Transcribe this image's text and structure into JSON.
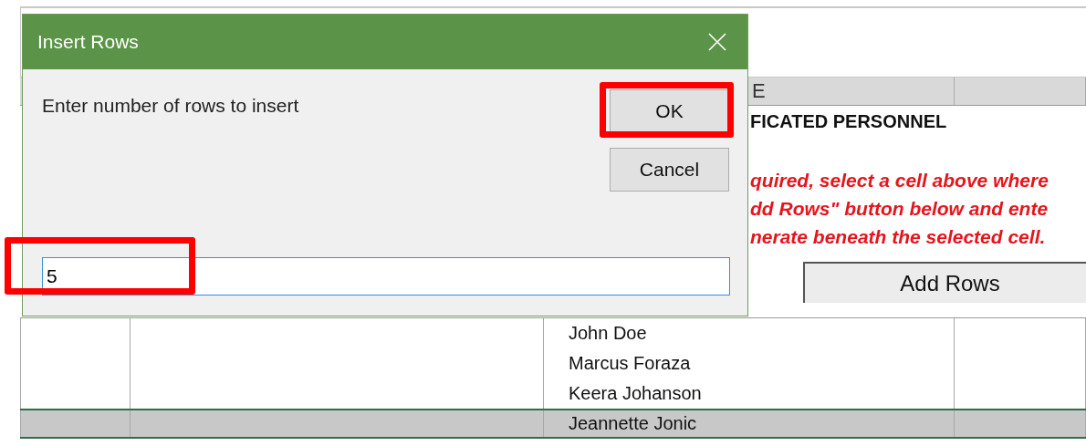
{
  "sheet": {
    "header_cells": [
      "",
      "",
      "E",
      ""
    ],
    "title": "FICATED PERSONNEL",
    "instructions": [
      "quired, select a cell above where",
      "dd Rows\" button below and ente",
      "nerate beneath the selected cell."
    ],
    "add_button": "Add Rows",
    "rows": [
      {
        "cells": [
          "",
          "",
          "John Doe",
          ""
        ],
        "selected": false
      },
      {
        "cells": [
          "",
          "",
          "Marcus Foraza",
          ""
        ],
        "selected": false
      },
      {
        "cells": [
          "",
          "",
          "Keera Johanson",
          ""
        ],
        "selected": false
      },
      {
        "cells": [
          "",
          "",
          "Jeannette Jonic",
          ""
        ],
        "selected": true
      }
    ]
  },
  "dialog": {
    "title": "Insert Rows",
    "prompt": "Enter number of rows to insert",
    "buttons": [
      "OK",
      "Cancel"
    ],
    "input_value": "5",
    "ok_highlighted": true,
    "input_highlighted": true
  }
}
